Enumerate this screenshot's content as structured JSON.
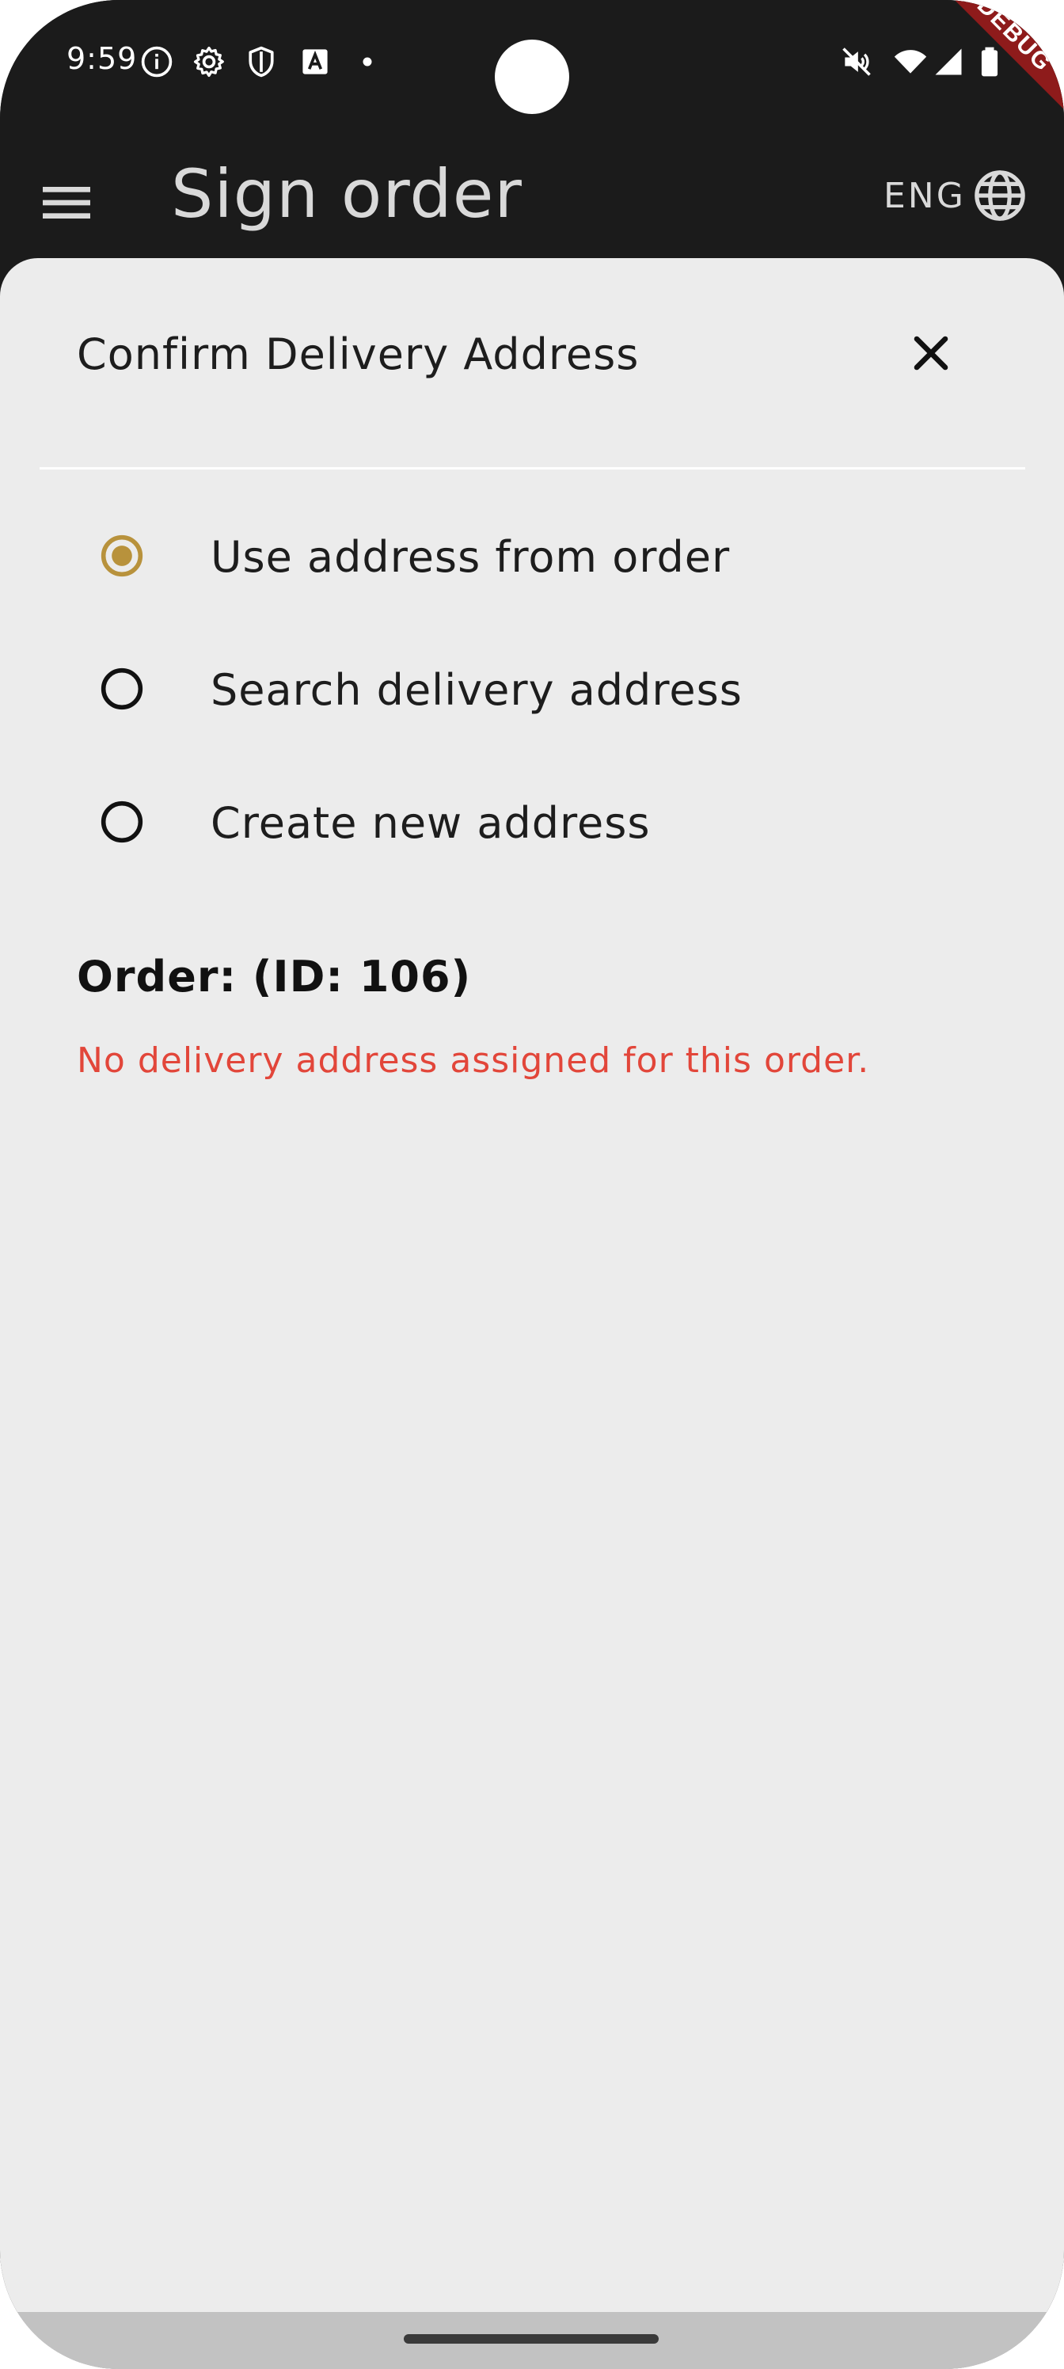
{
  "status_bar": {
    "time": "9:59",
    "debug_label": "DEBUG"
  },
  "app_bar": {
    "title": "Sign order",
    "language": "ENG"
  },
  "dialog": {
    "title": "Confirm Delivery Address",
    "options": [
      {
        "label": "Use address from order",
        "selected": true
      },
      {
        "label": "Search delivery address",
        "selected": false
      },
      {
        "label": "Create new address",
        "selected": false
      }
    ],
    "order_heading": "Order:  (ID: 106)",
    "order_warning": "No delivery address assigned for this order."
  },
  "colors": {
    "accent": "#b8923c",
    "error": "#e2463a",
    "app_bar": "#1b1b1b",
    "sheet": "#ececec"
  },
  "icons": {
    "menu": "menu-icon",
    "globe": "globe-icon",
    "close": "close-icon",
    "radio_selected": "radio-selected-icon",
    "radio_unselected": "radio-unselected-icon"
  }
}
